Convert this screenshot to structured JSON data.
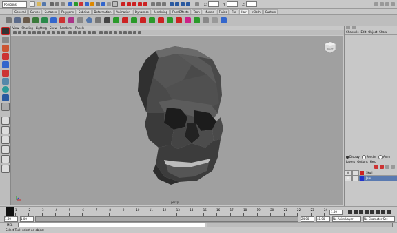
{
  "status_line": {
    "menu_set": "Polygons",
    "x_label": "X:",
    "y_label": "Y:",
    "z_label": "Z:"
  },
  "shelf_tabs": [
    "General",
    "Curves",
    "Surfaces",
    "Polygons",
    "Subdivs",
    "Deformation",
    "Animation",
    "Dynamics",
    "Rendering",
    "PaintEffects",
    "Toon",
    "Muscle",
    "Fluids",
    "Fur",
    "Hair",
    "nCloth",
    "Custom"
  ],
  "active_shelf": "Hair",
  "panel_menu": [
    "View",
    "Shading",
    "Lighting",
    "Show",
    "Renderer",
    "Panels"
  ],
  "viewport": {
    "camera": "persp",
    "viewcube_label": "RIGHT"
  },
  "channel_box": {
    "menu": [
      "Channels",
      "Edit",
      "Object",
      "Show"
    ]
  },
  "layer_editor": {
    "tabs": [
      "Display",
      "Render",
      "Anim"
    ],
    "menu": [
      "Layers",
      "Options",
      "Help"
    ],
    "layers": [
      {
        "v": "V",
        "name": "Skull",
        "color": "#cc2222"
      },
      {
        "v": "V",
        "name": "Jaw",
        "color": "#2233cc"
      }
    ]
  },
  "timeline": {
    "ticks": [
      "1",
      "2",
      "3",
      "4",
      "5",
      "6",
      "7",
      "8",
      "9",
      "10",
      "11",
      "12",
      "13",
      "14",
      "15",
      "16",
      "17",
      "18",
      "19",
      "20",
      "21",
      "22",
      "23",
      "24"
    ],
    "current_frame": "1.00"
  },
  "range": {
    "start": "1.00",
    "range_start": "1.00",
    "range_end": "24.00",
    "end": "48.00",
    "anim_layer": "No Anim Layer",
    "char_set": "No Character Set"
  },
  "command_line": {
    "label": "MEL"
  },
  "help_line": {
    "text": "Select Tool: select an object"
  }
}
